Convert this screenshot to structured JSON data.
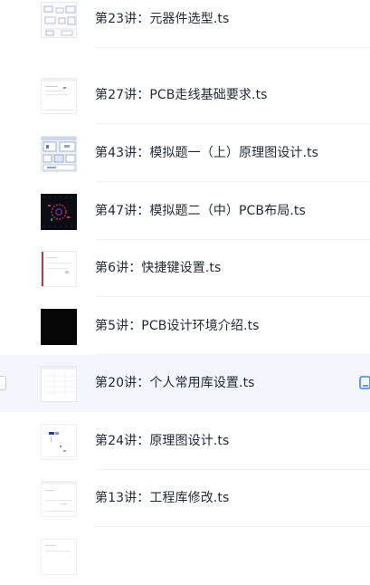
{
  "files": [
    {
      "name": "第23讲：元器件选型.ts",
      "thumb": "schematic-light"
    },
    {
      "name": "第27讲：PCB走线基础要求.ts",
      "thumb": "doc-white"
    },
    {
      "name": "第43讲：模拟题一（上）原理图设计.ts",
      "thumb": "schematic-blue"
    },
    {
      "name": "第47讲：模拟题二（中）PCB布局.ts",
      "thumb": "pcb-dark"
    },
    {
      "name": "第6讲：快捷键设置.ts",
      "thumb": "dialog-red-edge"
    },
    {
      "name": "第5讲：PCB设计环境介绍.ts",
      "thumb": "black"
    },
    {
      "name": "第20讲：个人常用库设置.ts",
      "thumb": "doc-grid"
    },
    {
      "name": "第24讲：原理图设计.ts",
      "thumb": "schematic-sparse"
    },
    {
      "name": "第13讲：工程库修改.ts",
      "thumb": "doc-lines"
    },
    {
      "name": "",
      "thumb": "partial"
    }
  ],
  "hovered_index": 6,
  "colors": {
    "hover_background": "#f3f6fc",
    "action_icon": "#3b82f6",
    "text": "#1f2937"
  }
}
